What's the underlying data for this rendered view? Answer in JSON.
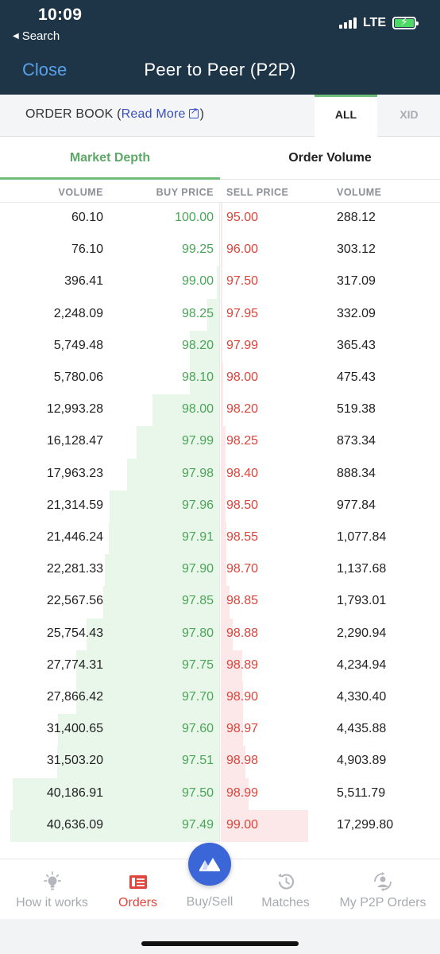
{
  "status_bar": {
    "time": "10:09",
    "back_app": "Search",
    "network": "LTE"
  },
  "nav": {
    "close_label": "Close",
    "title": "Peer to Peer (P2P)"
  },
  "order_book": {
    "label_prefix": "ORDER BOOK (",
    "read_more": "Read More",
    "label_suffix": ")",
    "segments": [
      "ALL",
      "XID"
    ],
    "active_segment": "ALL"
  },
  "subtabs": {
    "market_depth": "Market Depth",
    "order_volume": "Order Volume",
    "active": "Market Depth"
  },
  "columns": {
    "buy_volume": "VOLUME",
    "buy_price": "BUY PRICE",
    "sell_price": "SELL PRICE",
    "sell_volume": "VOLUME"
  },
  "rows": [
    {
      "buy_volume": "60.10",
      "buy_price": "100.00",
      "sell_price": "95.00",
      "sell_volume": "288.12"
    },
    {
      "buy_volume": "76.10",
      "buy_price": "99.25",
      "sell_price": "96.00",
      "sell_volume": "303.12"
    },
    {
      "buy_volume": "396.41",
      "buy_price": "99.00",
      "sell_price": "97.50",
      "sell_volume": "317.09"
    },
    {
      "buy_volume": "2,248.09",
      "buy_price": "98.25",
      "sell_price": "97.95",
      "sell_volume": "332.09"
    },
    {
      "buy_volume": "5,749.48",
      "buy_price": "98.20",
      "sell_price": "97.99",
      "sell_volume": "365.43"
    },
    {
      "buy_volume": "5,780.06",
      "buy_price": "98.10",
      "sell_price": "98.00",
      "sell_volume": "475.43"
    },
    {
      "buy_volume": "12,993.28",
      "buy_price": "98.00",
      "sell_price": "98.20",
      "sell_volume": "519.38"
    },
    {
      "buy_volume": "16,128.47",
      "buy_price": "97.99",
      "sell_price": "98.25",
      "sell_volume": "873.34"
    },
    {
      "buy_volume": "17,963.23",
      "buy_price": "97.98",
      "sell_price": "98.40",
      "sell_volume": "888.34"
    },
    {
      "buy_volume": "21,314.59",
      "buy_price": "97.96",
      "sell_price": "98.50",
      "sell_volume": "977.84"
    },
    {
      "buy_volume": "21,446.24",
      "buy_price": "97.91",
      "sell_price": "98.55",
      "sell_volume": "1,077.84"
    },
    {
      "buy_volume": "22,281.33",
      "buy_price": "97.90",
      "sell_price": "98.70",
      "sell_volume": "1,137.68"
    },
    {
      "buy_volume": "22,567.56",
      "buy_price": "97.85",
      "sell_price": "98.85",
      "sell_volume": "1,793.01"
    },
    {
      "buy_volume": "25,754.43",
      "buy_price": "97.80",
      "sell_price": "98.88",
      "sell_volume": "2,290.94"
    },
    {
      "buy_volume": "27,774.31",
      "buy_price": "97.75",
      "sell_price": "98.89",
      "sell_volume": "4,234.94"
    },
    {
      "buy_volume": "27,866.42",
      "buy_price": "97.70",
      "sell_price": "98.90",
      "sell_volume": "4,330.40"
    },
    {
      "buy_volume": "31,400.65",
      "buy_price": "97.60",
      "sell_price": "98.97",
      "sell_volume": "4,435.88"
    },
    {
      "buy_volume": "31,503.20",
      "buy_price": "97.51",
      "sell_price": "98.98",
      "sell_volume": "4,903.89"
    },
    {
      "buy_volume": "40,186.91",
      "buy_price": "97.50",
      "sell_price": "98.99",
      "sell_volume": "5,511.79"
    },
    {
      "buy_volume": "40,636.09",
      "buy_price": "97.49",
      "sell_price": "99.00",
      "sell_volume": "17,299.80"
    }
  ],
  "tabbar": {
    "items": [
      {
        "label": "How it works",
        "icon": "lightbulb-icon"
      },
      {
        "label": "Orders",
        "icon": "orders-icon",
        "active": true
      },
      {
        "label": "Buy/Sell",
        "icon": "wazirx-logo-icon"
      },
      {
        "label": "Matches",
        "icon": "history-icon"
      },
      {
        "label": "My P2P Orders",
        "icon": "user-sync-icon"
      }
    ]
  },
  "colors": {
    "header_bg": "#1e3547",
    "close_link": "#5aa0ea",
    "accent_green": "#6fbd78",
    "buy_price": "#4aa557",
    "sell_price": "#d9443b",
    "buy_depth": "#e9f6ea",
    "sell_depth": "#fce8e8",
    "active_tab": "#e0463d",
    "fab": "#3b66d8"
  }
}
